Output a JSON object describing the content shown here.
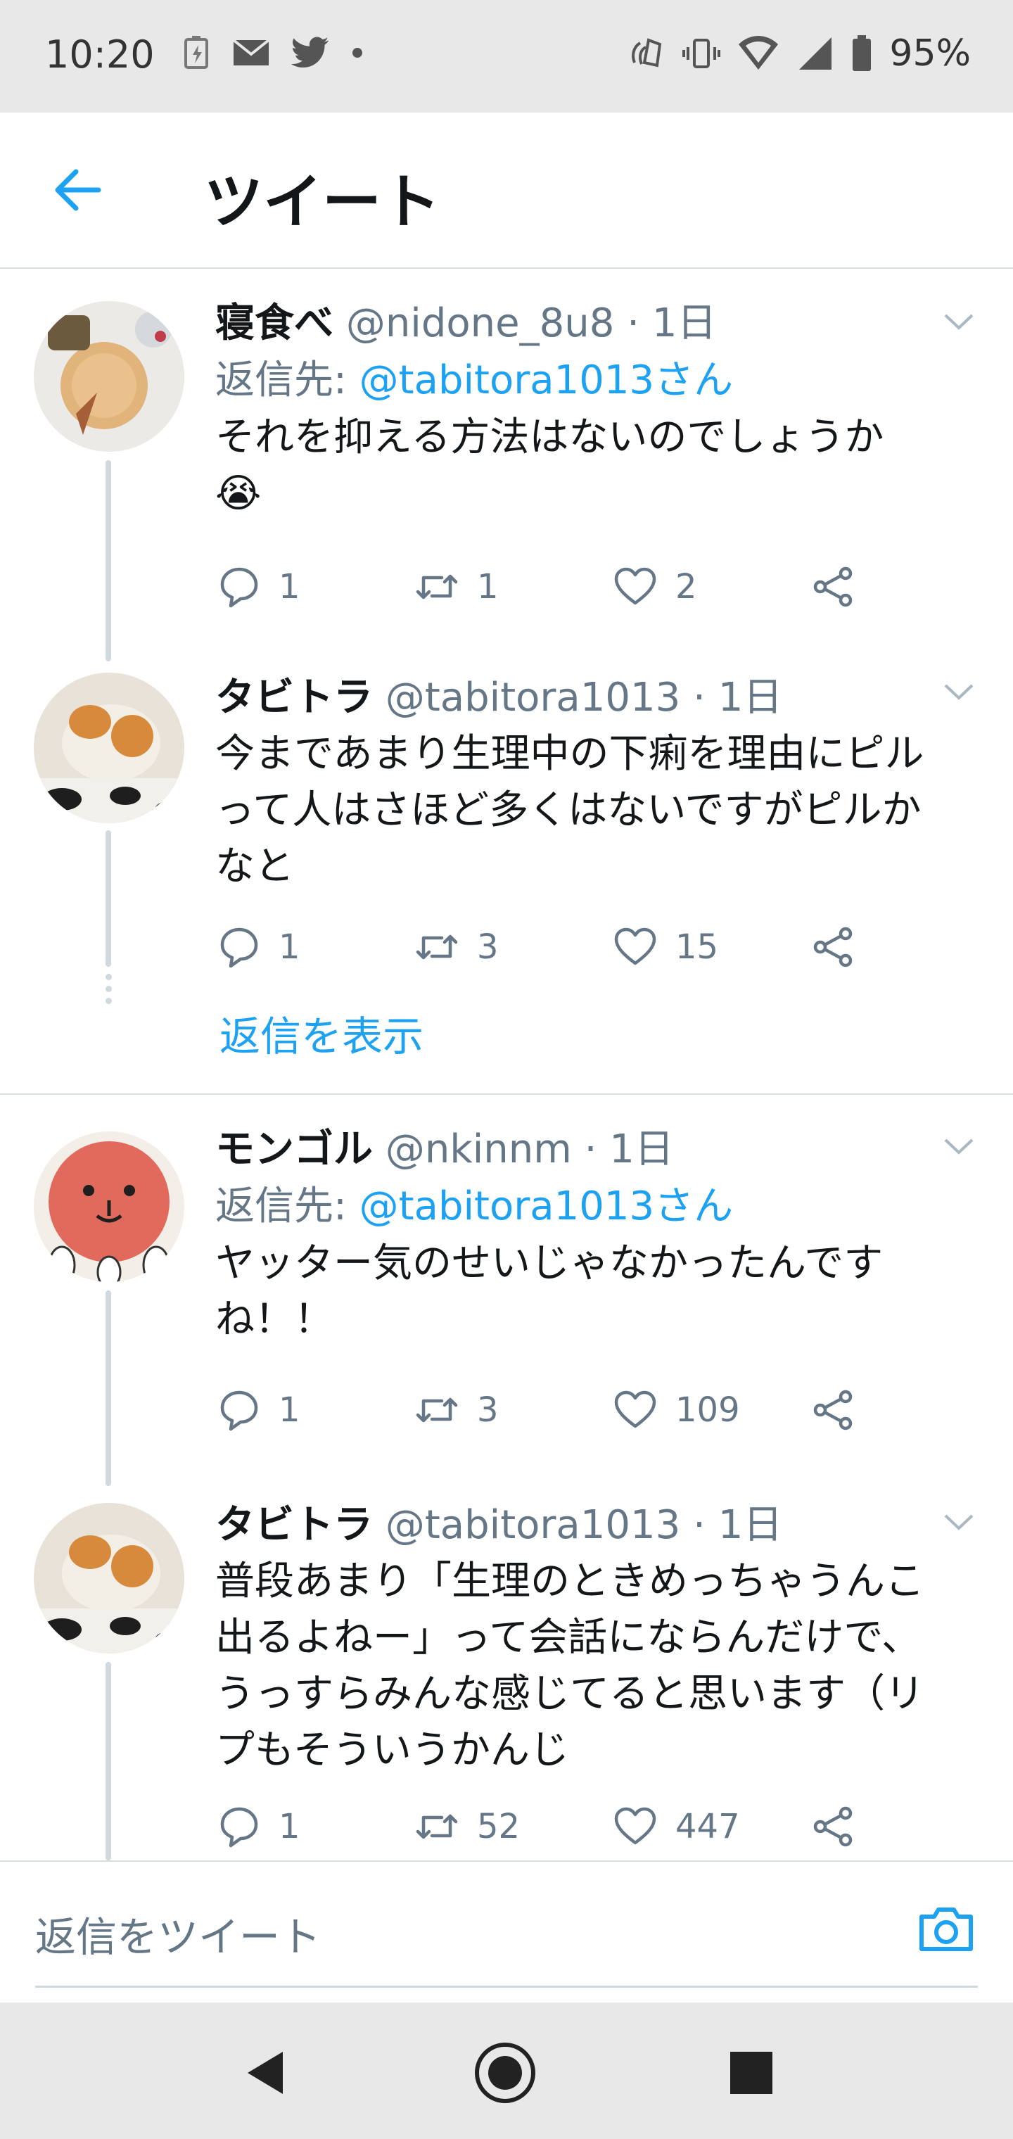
{
  "status_bar": {
    "time": "10:20",
    "battery": "95%",
    "left_icons": [
      "battery-saver-icon",
      "mail-icon",
      "twitter-icon",
      "dot-icon"
    ],
    "right_icons": [
      "nfc-icon",
      "vibrate-icon",
      "wifi-icon",
      "signal-icon",
      "battery-icon"
    ]
  },
  "header": {
    "title": "ツイート",
    "back_icon": "arrow-left-icon"
  },
  "tweets": [
    {
      "name": "寝食べ",
      "handle": "@nidone_8u8",
      "separator": "·",
      "time": "1日",
      "reply_prefix": "返信先: ",
      "reply_to": "@tabitora1013さん",
      "text_lines": [
        "それを抑える方法はないのでしょうか",
        "😭"
      ],
      "replies": "1",
      "retweets": "1",
      "likes": "2"
    },
    {
      "name": "タビトラ",
      "handle": "@tabitora1013",
      "separator": "·",
      "time": "1日",
      "text_lines": [
        "今まであまり生理中の下痢を理由にピル",
        "って人はさほど多くはないですがピルか",
        "なと"
      ],
      "replies": "1",
      "retweets": "3",
      "likes": "15",
      "show_replies": "返信を表示"
    },
    {
      "name": "モンゴル",
      "handle": "@nkinnm",
      "separator": "·",
      "time": "1日",
      "reply_prefix": "返信先: ",
      "reply_to": "@tabitora1013さん",
      "text_lines": [
        "ヤッター気のせいじゃなかったんです",
        "ね！！"
      ],
      "replies": "1",
      "retweets": "3",
      "likes": "109"
    },
    {
      "name": "タビトラ",
      "handle": "@tabitora1013",
      "separator": "·",
      "time": "1日",
      "text_lines": [
        "普段あまり「生理のときめっちゃうんこ",
        "出るよねー」って会話にならんだけで、",
        "うっすらみんな感じてると思います（リ",
        "プもそういうかんじ"
      ],
      "replies": "1",
      "retweets": "52",
      "likes": "447"
    }
  ],
  "composer": {
    "placeholder": "返信をツイート",
    "camera_icon": "camera-icon"
  },
  "colors": {
    "accent": "#1da1f2",
    "secondary_text": "#657786",
    "primary_text": "#14171a",
    "divider": "#d8dde1"
  }
}
